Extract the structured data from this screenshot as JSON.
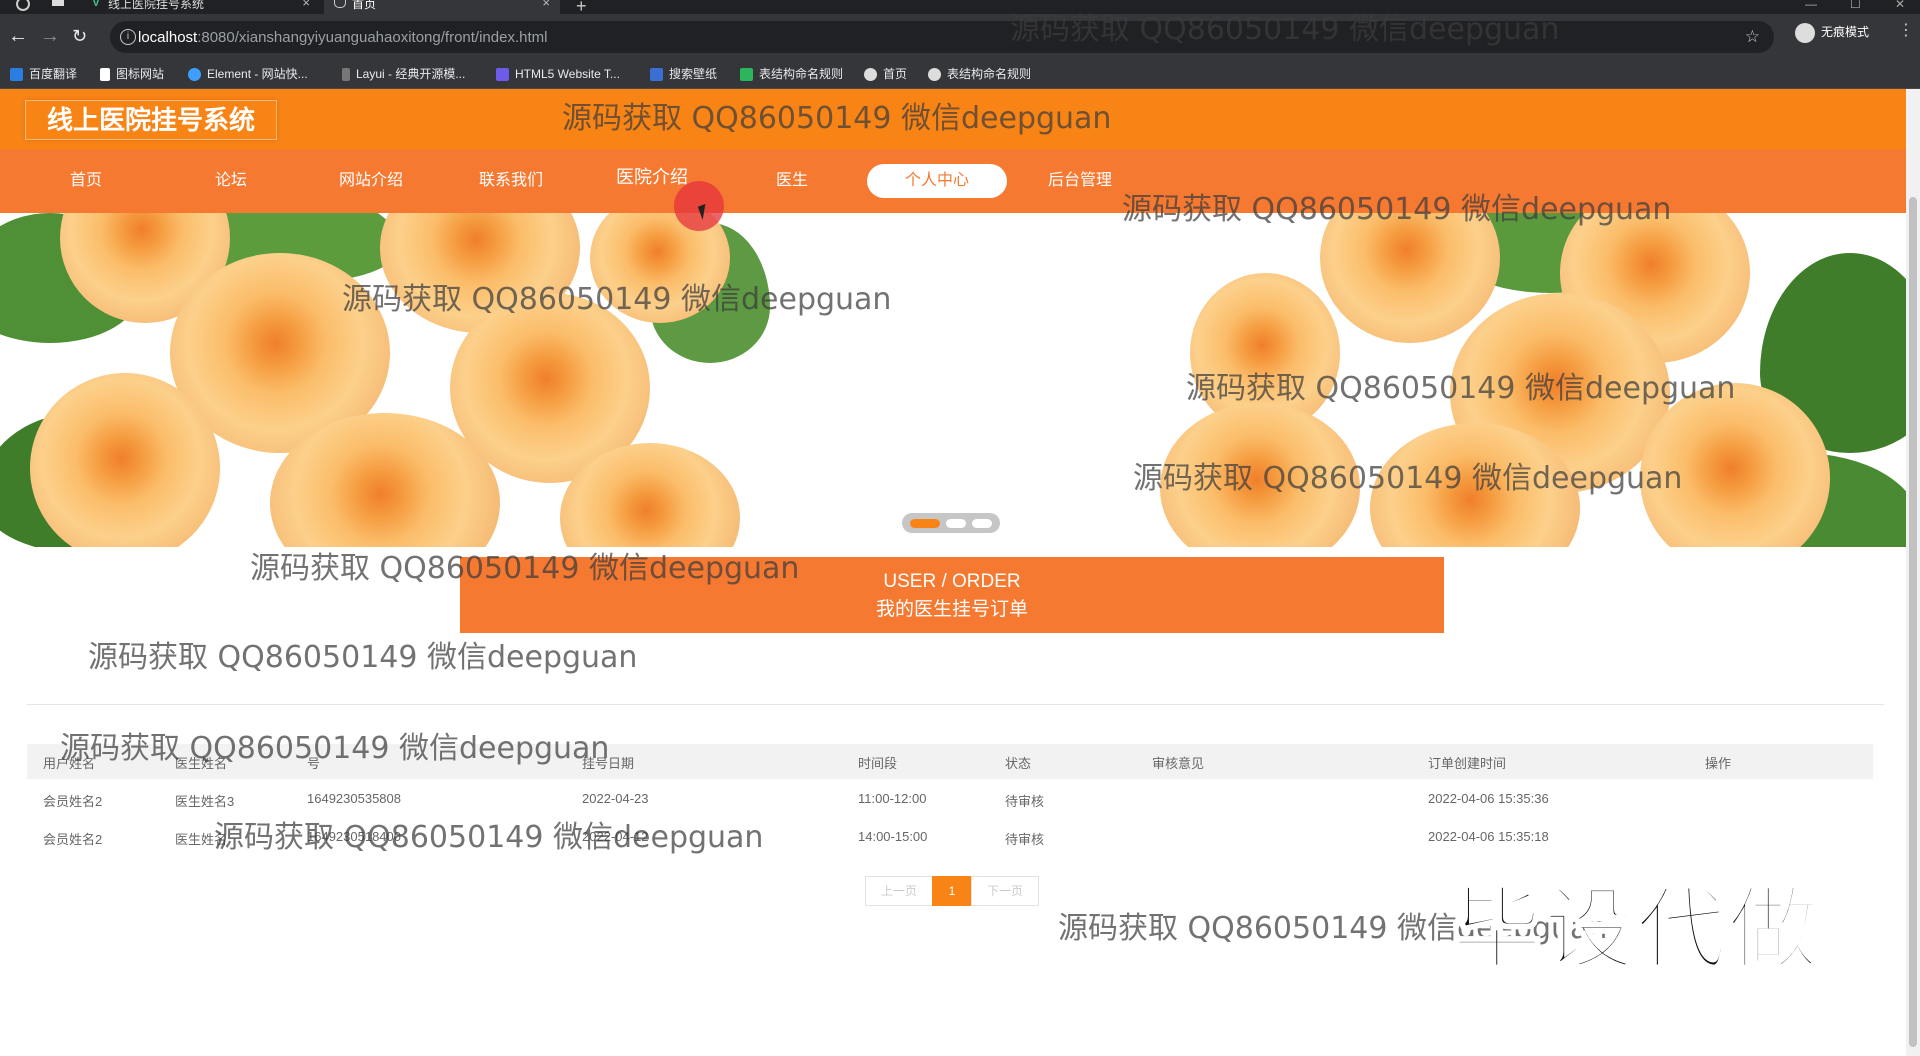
{
  "browser": {
    "tabs": [
      {
        "title": "线上医院挂号系统",
        "active": false
      },
      {
        "title": "首页",
        "active": true
      }
    ],
    "url_host": "localhost",
    "url_path": ":8080/xianshangyiyuanguahaoxitong/front/index.html",
    "profile_label": "无痕模式",
    "bookmarks": [
      "百度翻译",
      "图标网站",
      "Element - 网站快...",
      "Layui - 经典开源模...",
      "HTML5 Website T...",
      "搜索壁纸",
      "表结构命名规则",
      "首页",
      "表结构命名规则"
    ]
  },
  "site": {
    "logo": "线上医院挂号系统",
    "nav": [
      "首页",
      "论坛",
      "网站介绍",
      "联系我们",
      "医院介绍",
      "医生",
      "个人中心",
      "后台管理"
    ],
    "active_nav": "个人中心",
    "accent_color": "#f98416"
  },
  "banner": {
    "slides": 3,
    "active_slide": 1
  },
  "orders": {
    "title_en": "USER / ORDER",
    "title_cn": "我的医生挂号订单",
    "columns": [
      "用户姓名",
      "医生姓名",
      "号",
      "挂号日期",
      "时间段",
      "状态",
      "审核意见",
      "订单创建时间",
      "操作"
    ],
    "rows": [
      [
        "会员姓名2",
        "医生姓名3",
        "1649230535808",
        "2022-04-23",
        "11:00-12:00",
        "待审核",
        "",
        "2022-04-06 15:35:36",
        ""
      ],
      [
        "会员姓名2",
        "医生姓名",
        "1649230518400",
        "2022-04-12",
        "14:00-15:00",
        "待审核",
        "",
        "2022-04-06 15:35:18",
        ""
      ]
    ],
    "pagination": {
      "prev": "上一页",
      "current": "1",
      "next": "下一页"
    }
  },
  "watermarks": {
    "text": "源码获取 QQ86050149 微信deepguan",
    "badge": "毕设代做"
  }
}
